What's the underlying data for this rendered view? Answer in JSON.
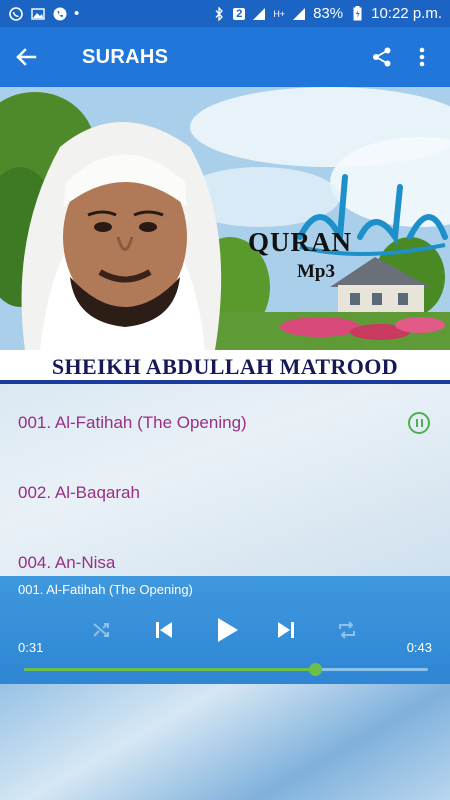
{
  "status_bar": {
    "battery": "83%",
    "time": "10:22 p.m.",
    "sim_badge": "2",
    "network": "H+"
  },
  "appbar": {
    "title": "SURAHS"
  },
  "banner": {
    "title_main": "QURAN",
    "title_sub": "Mp3",
    "caption": "SHEIKH ABDULLAH MATROOD"
  },
  "surahs": [
    {
      "label": "001. Al-Fatihah (The Opening)",
      "playing": true
    },
    {
      "label": "002. Al-Baqarah",
      "playing": false
    },
    {
      "label": "004. An-Nisa",
      "playing": false
    }
  ],
  "player": {
    "now_playing": "001. Al-Fatihah (The Opening)",
    "elapsed": "0:31",
    "duration": "0:43",
    "progress": 0.72
  },
  "colors": {
    "primary": "#2177d9",
    "status_bar": "#1b64c3",
    "surah_text": "#9a2f86",
    "accent_green": "#4caf50"
  }
}
